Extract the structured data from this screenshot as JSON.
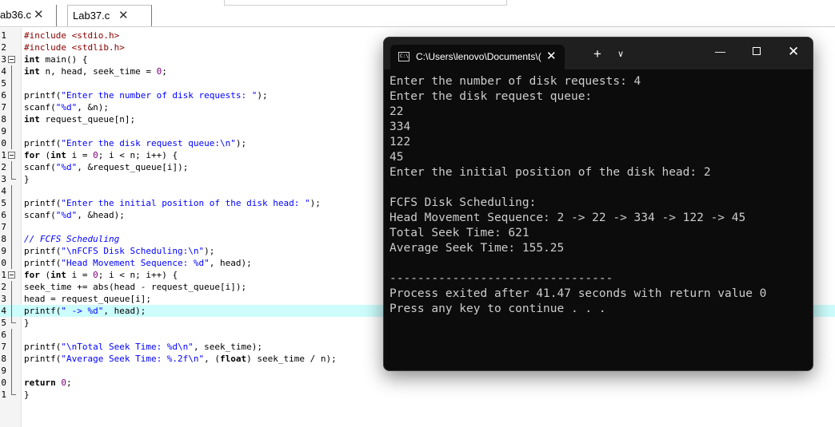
{
  "tabs": [
    {
      "label": "ab36.c",
      "close": "✕"
    },
    {
      "label": "Lab37.c",
      "close": "✕"
    }
  ],
  "editor": {
    "line_numbers": [
      "1",
      "2",
      "3",
      "4",
      "5",
      "6",
      "7",
      "8",
      "9",
      "0",
      "1",
      "2",
      "3",
      "4",
      "5",
      "6",
      "7",
      "8",
      "9",
      "0",
      "1",
      "2",
      "3",
      "4",
      "5",
      "6",
      "7",
      "8",
      "9",
      "0",
      "1"
    ],
    "code": [
      [
        [
          "p",
          "#include <stdio.h>"
        ]
      ],
      [
        [
          "p",
          "#include <stdlib.h>"
        ]
      ],
      [
        [
          "k",
          "int"
        ],
        [
          "t",
          " main() {"
        ]
      ],
      [
        [
          "k",
          "int"
        ],
        [
          "t",
          " n, head, seek_time = "
        ],
        [
          "n",
          "0"
        ],
        [
          "t",
          ";"
        ]
      ],
      [],
      [
        [
          "t",
          "printf("
        ],
        [
          "s",
          "\"Enter the number of disk requests: \""
        ],
        [
          "t",
          ");"
        ]
      ],
      [
        [
          "t",
          "scanf("
        ],
        [
          "s",
          "\"%d\""
        ],
        [
          "t",
          ", &n);"
        ]
      ],
      [
        [
          "k",
          "int"
        ],
        [
          "t",
          " request_queue[n];"
        ]
      ],
      [],
      [
        [
          "t",
          "printf("
        ],
        [
          "s",
          "\"Enter the disk request queue:\\n\""
        ],
        [
          "t",
          ");"
        ]
      ],
      [
        [
          "k",
          "for"
        ],
        [
          "t",
          " ("
        ],
        [
          "k",
          "int"
        ],
        [
          "t",
          " i = "
        ],
        [
          "n",
          "0"
        ],
        [
          "t",
          "; i < n; i++) {"
        ]
      ],
      [
        [
          "t",
          "scanf("
        ],
        [
          "s",
          "\"%d\""
        ],
        [
          "t",
          ", &request_queue[i]);"
        ]
      ],
      [
        [
          "t",
          "}"
        ]
      ],
      [],
      [
        [
          "t",
          "printf("
        ],
        [
          "s",
          "\"Enter the initial position of the disk head: \""
        ],
        [
          "t",
          ");"
        ]
      ],
      [
        [
          "t",
          "scanf("
        ],
        [
          "s",
          "\"%d\""
        ],
        [
          "t",
          ", &head);"
        ]
      ],
      [],
      [
        [
          "c",
          "// FCFS Scheduling"
        ]
      ],
      [
        [
          "t",
          "printf("
        ],
        [
          "s",
          "\"\\nFCFS Disk Scheduling:\\n\""
        ],
        [
          "t",
          ");"
        ]
      ],
      [
        [
          "t",
          "printf("
        ],
        [
          "s",
          "\"Head Movement Sequence: %d\""
        ],
        [
          "t",
          ", head);"
        ]
      ],
      [
        [
          "k",
          "for"
        ],
        [
          "t",
          " ("
        ],
        [
          "k",
          "int"
        ],
        [
          "t",
          " i = "
        ],
        [
          "n",
          "0"
        ],
        [
          "t",
          "; i < n; i++) {"
        ]
      ],
      [
        [
          "t",
          "seek_time += abs(head - request_queue[i]);"
        ]
      ],
      [
        [
          "t",
          "head = request_queue[i];"
        ]
      ],
      [
        [
          "t",
          "printf("
        ],
        [
          "s",
          "\" -> %d\""
        ],
        [
          "t",
          ", head);"
        ]
      ],
      [
        [
          "t",
          "}"
        ]
      ],
      [],
      [
        [
          "t",
          "printf("
        ],
        [
          "s",
          "\"\\nTotal Seek Time: %d\\n\""
        ],
        [
          "t",
          ", seek_time);"
        ]
      ],
      [
        [
          "t",
          "printf("
        ],
        [
          "s",
          "\"Average Seek Time: %.2f\\n\""
        ],
        [
          "t",
          ", ("
        ],
        [
          "k",
          "float"
        ],
        [
          "t",
          ") seek_time / n);"
        ]
      ],
      [],
      [
        [
          "k",
          "return"
        ],
        [
          "t",
          " "
        ],
        [
          "n",
          "0"
        ],
        [
          "t",
          ";"
        ]
      ],
      [
        [
          "t",
          "}"
        ]
      ]
    ]
  },
  "terminal": {
    "tab_title": "C:\\Users\\lenovo\\Documents\\(",
    "tab_icon_text": "C:\\",
    "tab_close": "✕",
    "new_tab": "+",
    "dropdown": "∨",
    "minimize": "—",
    "close": "✕",
    "lines": [
      "Enter the number of disk requests: 4",
      "Enter the disk request queue:",
      "22",
      "334",
      "122",
      "45",
      "Enter the initial position of the disk head: 2",
      "",
      "FCFS Disk Scheduling:",
      "Head Movement Sequence: 2 -> 22 -> 334 -> 122 -> 45",
      "Total Seek Time: 621",
      "Average Seek Time: 155.25",
      "",
      "--------------------------------",
      "Process exited after 41.47 seconds with return value 0",
      "Press any key to continue . . ."
    ]
  },
  "colors": {
    "highlight_line": "#ccfcfc",
    "preprocessor": "#880000",
    "string": "#0000ff",
    "number": "#800080",
    "comment": "#0000ff",
    "terminal_bg": "#0c0c0c",
    "terminal_text": "#cccccc"
  }
}
